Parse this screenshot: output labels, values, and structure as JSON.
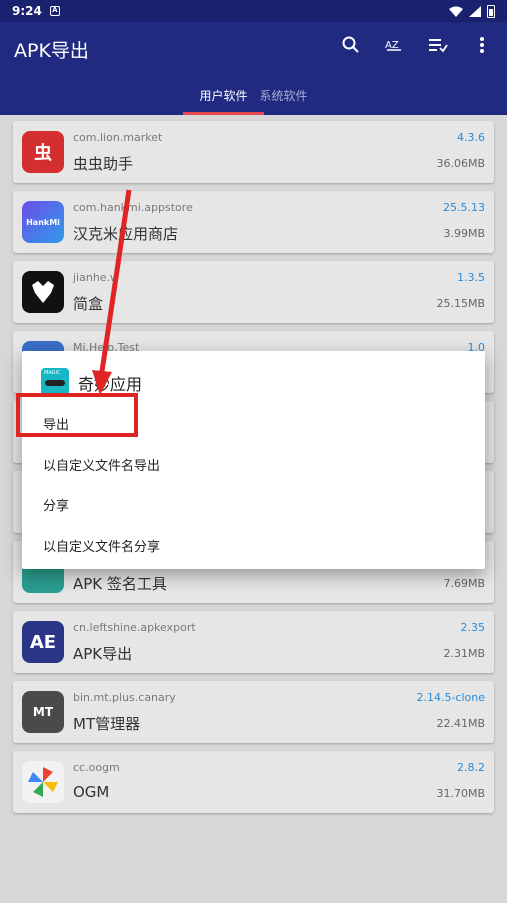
{
  "status": {
    "time": "9:24",
    "notif": "A"
  },
  "app": {
    "title": "APK导出"
  },
  "actions": {
    "search": "search-icon",
    "sort": "sort-az-icon",
    "filter": "filter-list-icon",
    "more": "more-vert-icon"
  },
  "tabs": [
    {
      "label": "用户软件",
      "active": true
    },
    {
      "label": "系统软件",
      "active": false
    }
  ],
  "apps": [
    {
      "pkg": "com.lion.market",
      "name": "虫虫助手",
      "version": "4.3.6",
      "size": "36.06MB",
      "icon_color": "#d32f2f",
      "icon_text": "虫"
    },
    {
      "pkg": "com.hankmi.appstore",
      "name": "汉克米应用商店",
      "version": "25.5.13",
      "size": "3.99MB",
      "icon_color": "#7b3fd6",
      "icon_text": "HankMi"
    },
    {
      "pkg": "jianhe.w",
      "name": "简盒",
      "version": "1.3.5",
      "size": "25.15MB",
      "icon_color": "#111111",
      "icon_text": ""
    },
    {
      "pkg": "Mi.Help.Test",
      "name": "",
      "version": "1.0",
      "size": "",
      "icon_color": "#3a6fc8",
      "icon_text": ""
    },
    {
      "pkg": "",
      "name": "APK 签名工具",
      "version": "",
      "size": "7.69MB",
      "icon_color": "#2a9d8f",
      "icon_text": ""
    },
    {
      "pkg": "cn.leftshine.apkexport",
      "name": "APK导出",
      "version": "2.35",
      "size": "2.31MB",
      "icon_color": "#2a3585",
      "icon_text": "AE"
    },
    {
      "pkg": "bin.mt.plus.canary",
      "name": "MT管理器",
      "version": "2.14.5-clone",
      "size": "22.41MB",
      "icon_color": "#4a4a4a",
      "icon_text": "MT"
    },
    {
      "pkg": "cc.oogm",
      "name": "OGM",
      "version": "2.8.2",
      "size": "31.70MB",
      "icon_color": "#f2f2f2",
      "icon_text": ""
    }
  ],
  "dialog": {
    "title": "奇妙应用",
    "options": [
      "导出",
      "以自定义文件名导出",
      "分享",
      "以自定义文件名分享"
    ]
  },
  "annotation": {
    "color": "#e02424"
  }
}
